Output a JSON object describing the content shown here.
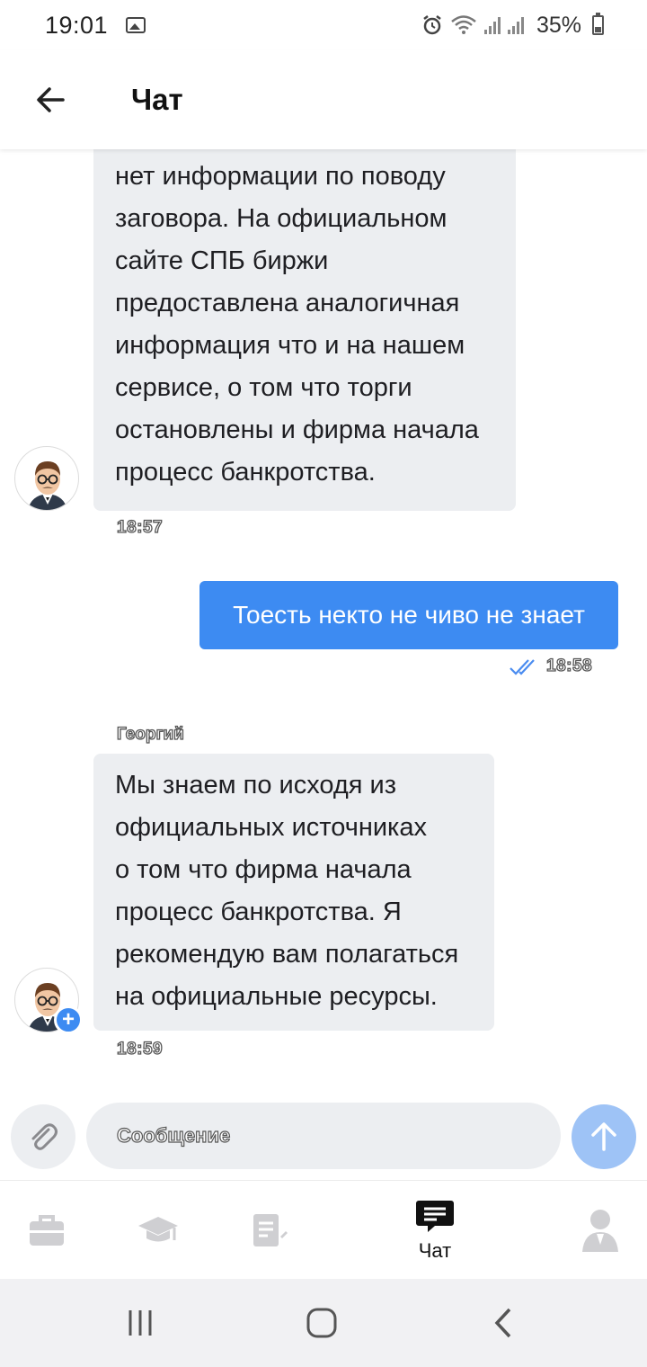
{
  "status_bar": {
    "time": "19:01",
    "battery": "35%"
  },
  "header": {
    "title": "Чат",
    "back_icon": "arrow-left-icon"
  },
  "messages": [
    {
      "direction": "incoming",
      "lines": [
        "нет информации по поводу",
        "заговора.  На официальном",
        "сайте СПБ биржи",
        "предоставлена аналогичная",
        "информация что и на нашем",
        "сервисе, о том что торги",
        "остановлены и фирма начала",
        "процесс банкротства."
      ],
      "time": "18:57"
    },
    {
      "direction": "outgoing",
      "text": "Тоесть некто не чиво не знает",
      "time": "18:58",
      "status_icon": "double-check-icon"
    },
    {
      "direction": "incoming",
      "sender": "Георгий",
      "lines": [
        "Мы знаем по исходя из",
        "официальных источниках",
        "о том что фирма начала",
        "процесс банкротства. Я",
        "рекомендую вам полагаться",
        "на официальные ресурсы."
      ],
      "time": "18:59"
    }
  ],
  "composer": {
    "placeholder": "Сообщение",
    "value": "",
    "attach_icon": "paperclip-icon",
    "send_icon": "arrow-up-icon"
  },
  "tabs": [
    {
      "icon": "briefcase-icon",
      "label": "",
      "active": false
    },
    {
      "icon": "graduation-cap-icon",
      "label": "",
      "active": false
    },
    {
      "icon": "document-icon",
      "label": "",
      "active": false
    },
    {
      "icon": "chat-icon",
      "label": "Чат",
      "active": true
    },
    {
      "icon": "profile-icon",
      "label": "",
      "active": false
    }
  ],
  "colors": {
    "accent": "#3d8bf2",
    "send_button": "#9ec3f6",
    "incoming_bubble": "#eceef1",
    "inactive_tab": "#cfcfd2"
  }
}
